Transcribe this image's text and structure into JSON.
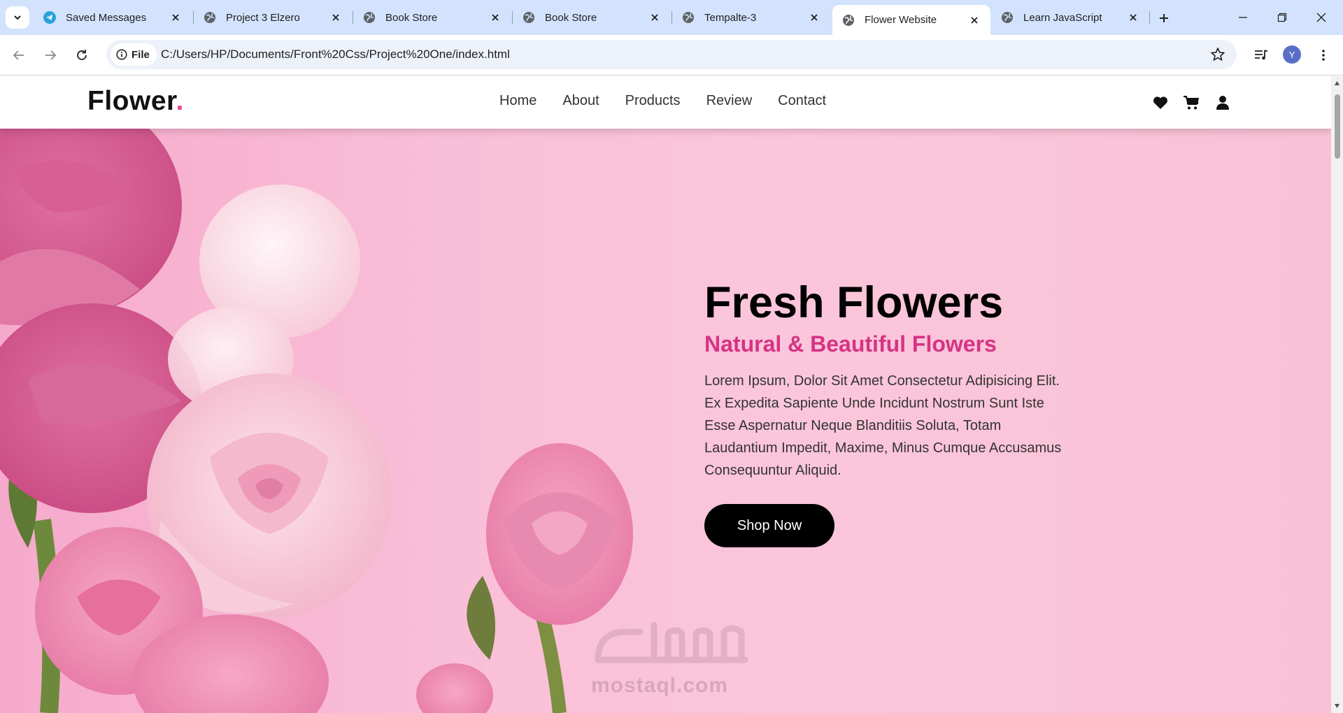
{
  "browser": {
    "tabs": [
      {
        "title": "Saved Messages",
        "icon": "telegram-icon",
        "active": false
      },
      {
        "title": "Project 3 Elzero",
        "icon": "globe-icon",
        "active": false
      },
      {
        "title": "Book Store",
        "icon": "globe-icon",
        "active": false
      },
      {
        "title": "Book Store",
        "icon": "globe-icon",
        "active": false
      },
      {
        "title": "Tempalte-3",
        "icon": "globe-icon",
        "active": false
      },
      {
        "title": "Flower Website",
        "icon": "globe-icon",
        "active": true
      },
      {
        "title": "Learn JavaScript",
        "icon": "globe-icon",
        "active": false
      }
    ],
    "site_chip_label": "File",
    "url": "C:/Users/HP/Documents/Front%20Css/Project%20One/index.html",
    "profile_initial": "Y"
  },
  "site": {
    "logo_text": "Flower",
    "logo_dot": ".",
    "nav": [
      "Home",
      "About",
      "Products",
      "Review",
      "Contact"
    ],
    "header_icons": [
      "heart-icon",
      "cart-icon",
      "user-icon"
    ],
    "hero": {
      "title": "Fresh Flowers",
      "subtitle": "Natural & Beautiful Flowers",
      "description": "Lorem Ipsum, Dolor Sit Amet Consectetur Adipisicing Elit. Ex Expedita Sapiente Unde Incidunt Nostrum Sunt Iste Esse Aspernatur Neque Blanditiis Soluta, Totam Laudantium Impedit, Maxime, Minus Cumque Accusamus Consequuntur Aliquid.",
      "button_label": "Shop Now"
    },
    "watermark": "mostaql.com"
  },
  "colors": {
    "accent_pink": "#e84393",
    "subtitle_pink": "#d63384",
    "tabstrip": "#d3e3fd",
    "omnibox": "#edf2fa"
  }
}
